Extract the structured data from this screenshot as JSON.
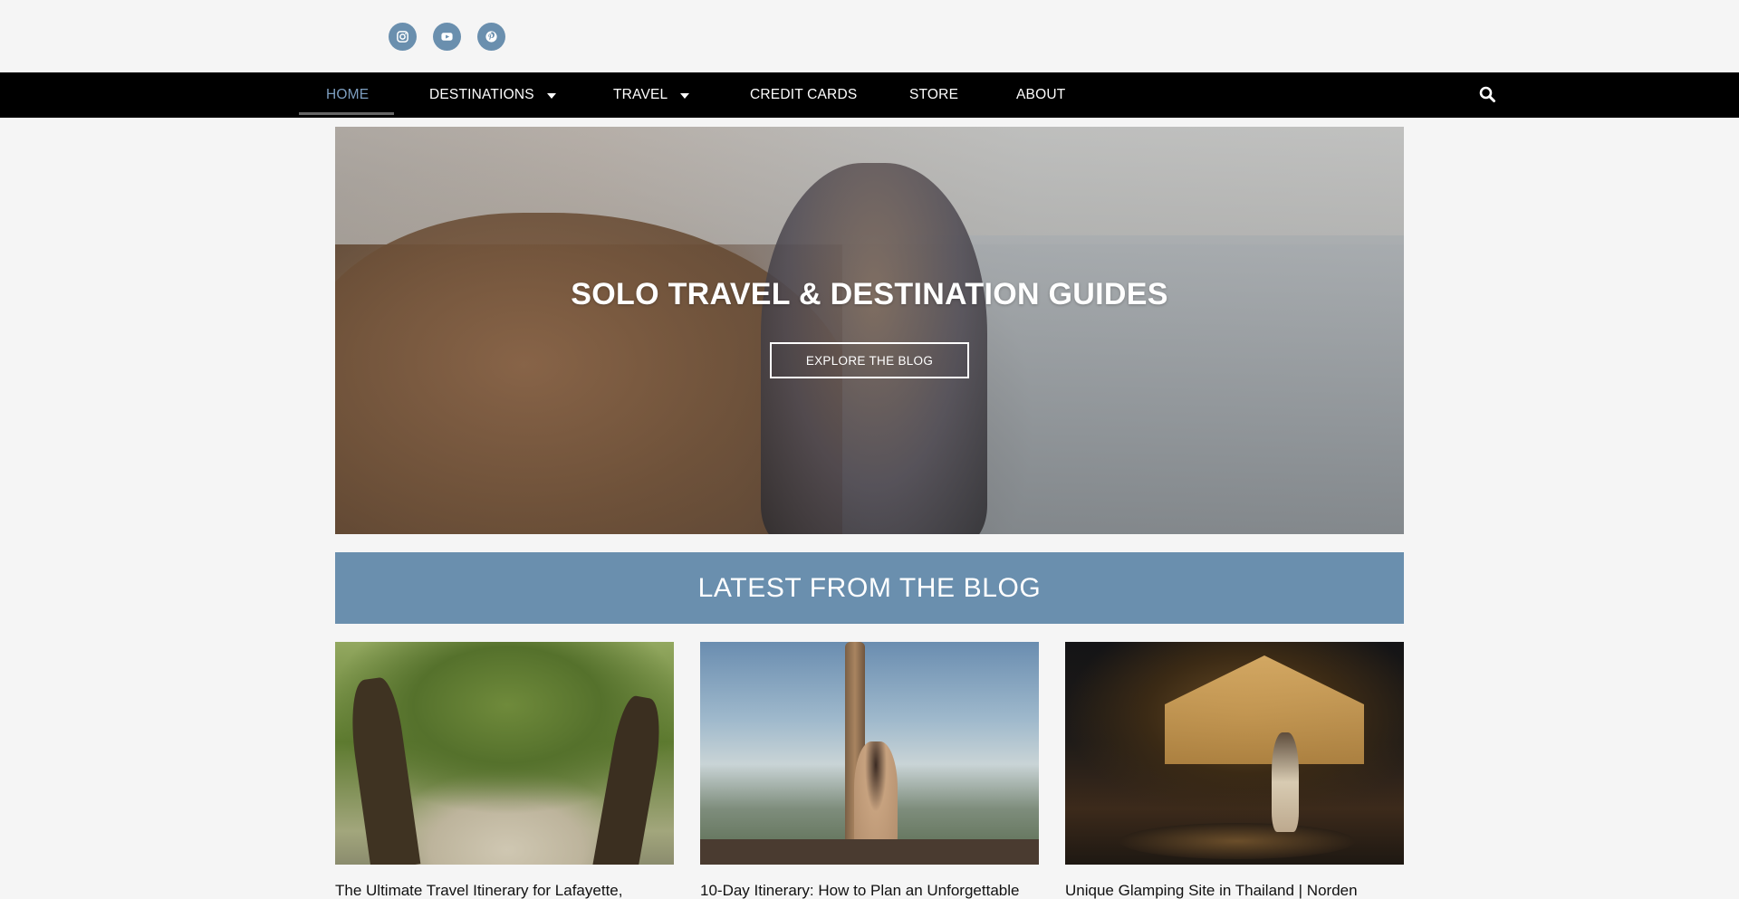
{
  "social": {
    "items": [
      {
        "name": "instagram",
        "icon": "instagram-icon"
      },
      {
        "name": "youtube",
        "icon": "youtube-icon"
      },
      {
        "name": "pinterest",
        "icon": "pinterest-icon"
      }
    ]
  },
  "nav": {
    "items": [
      {
        "label": "HOME",
        "active": true
      },
      {
        "label": "DESTINATIONS",
        "dropdown": true
      },
      {
        "label": "TRAVEL",
        "dropdown": true
      },
      {
        "label": "CREDIT CARDS"
      },
      {
        "label": "STORE"
      },
      {
        "label": "ABOUT"
      }
    ],
    "search_icon": "search-icon"
  },
  "hero": {
    "title": "SOLO TRAVEL & DESTINATION GUIDES",
    "button_label": "EXPLORE THE BLOG"
  },
  "blog": {
    "heading": "LATEST FROM THE BLOG",
    "posts": [
      {
        "title": "The Ultimate Travel Itinerary for Lafayette,"
      },
      {
        "title": "10-Day Itinerary: How to Plan an Unforgettable"
      },
      {
        "title": "Unique Glamping Site in Thailand | Norden"
      }
    ]
  },
  "colors": {
    "accent": "#6a8fae",
    "nav_background": "#000000",
    "nav_active": "#7d9ec0",
    "page_background": "#f5f5f5"
  }
}
